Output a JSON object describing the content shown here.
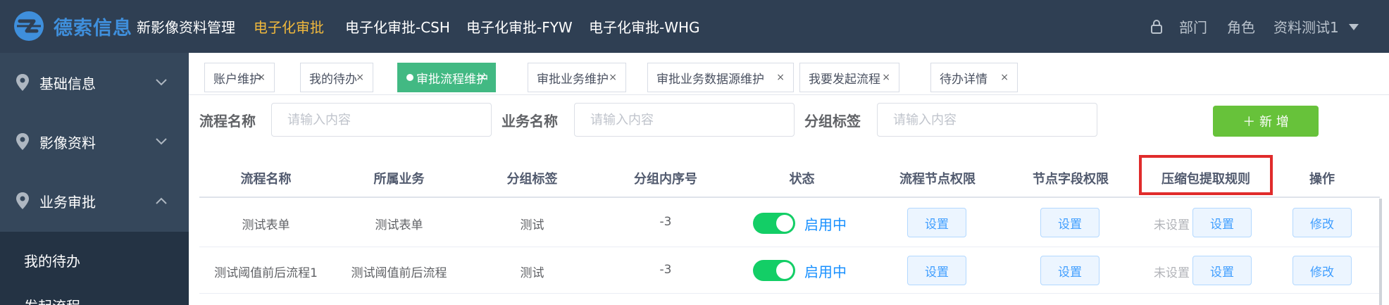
{
  "header": {
    "logo_text": "德索信息",
    "nav": [
      {
        "label": "新影像资料管理"
      },
      {
        "label": "电子化审批"
      },
      {
        "label": "电子化审批-CSH"
      },
      {
        "label": "电子化审批-FYW"
      },
      {
        "label": "电子化审批-WHG"
      }
    ],
    "active_nav": "电子化审批",
    "right": {
      "dept": "部门",
      "role": "角色",
      "user": "资料测试1"
    }
  },
  "sidebar": {
    "groups": [
      {
        "label": "基础信息",
        "expanded": false
      },
      {
        "label": "影像资料",
        "expanded": false
      },
      {
        "label": "业务审批",
        "expanded": true
      }
    ],
    "sub_items": [
      {
        "label": "我的待办"
      },
      {
        "label": "发起流程"
      }
    ]
  },
  "tabs": [
    {
      "label": "账户维护",
      "close": "×"
    },
    {
      "label": "我的待办",
      "close": "×"
    },
    {
      "label": "审批流程维护",
      "close": "×",
      "active": true
    },
    {
      "label": "审批业务维护",
      "close": "×"
    },
    {
      "label": "审批业务数据源维护",
      "close": "×"
    },
    {
      "label": "我要发起流程",
      "close": "×"
    },
    {
      "label": "待办详情",
      "close": "×"
    }
  ],
  "search": {
    "fields": [
      {
        "label": "流程名称",
        "placeholder": "请输入内容"
      },
      {
        "label": "业务名称",
        "placeholder": "请输入内容"
      },
      {
        "label": "分组标签",
        "placeholder": "请输入内容"
      }
    ],
    "add_label": "＋ 新 增"
  },
  "table": {
    "headers": [
      "流程名称",
      "所属业务",
      "分组标签",
      "分组内序号",
      "状态",
      "流程节点权限",
      "节点字段权限",
      "压缩包提取规则",
      "操作"
    ],
    "rows": [
      {
        "name": "测试表单",
        "business": "测试表单",
        "group": "测试",
        "order": "-3",
        "status": "启用中",
        "node_perm": "设置",
        "field_perm": "设置",
        "zip_status": "未设置",
        "zip_btn": "设置",
        "action": "修改"
      },
      {
        "name": "测试阈值前后流程1",
        "business": "测试阈值前后流程",
        "group": "测试",
        "order": "-3",
        "status": "启用中",
        "node_perm": "设置",
        "field_perm": "设置",
        "zip_status": "未设置",
        "zip_btn": "设置",
        "action": "修改"
      }
    ]
  },
  "colors": {
    "topbar": "#2f3f53",
    "sidebar": "#35475b",
    "accent_nav": "#f0b83c",
    "tab_active": "#42b983",
    "add_button": "#67c23a",
    "switch_on": "#13ce66",
    "highlight": "#e02b2b"
  }
}
